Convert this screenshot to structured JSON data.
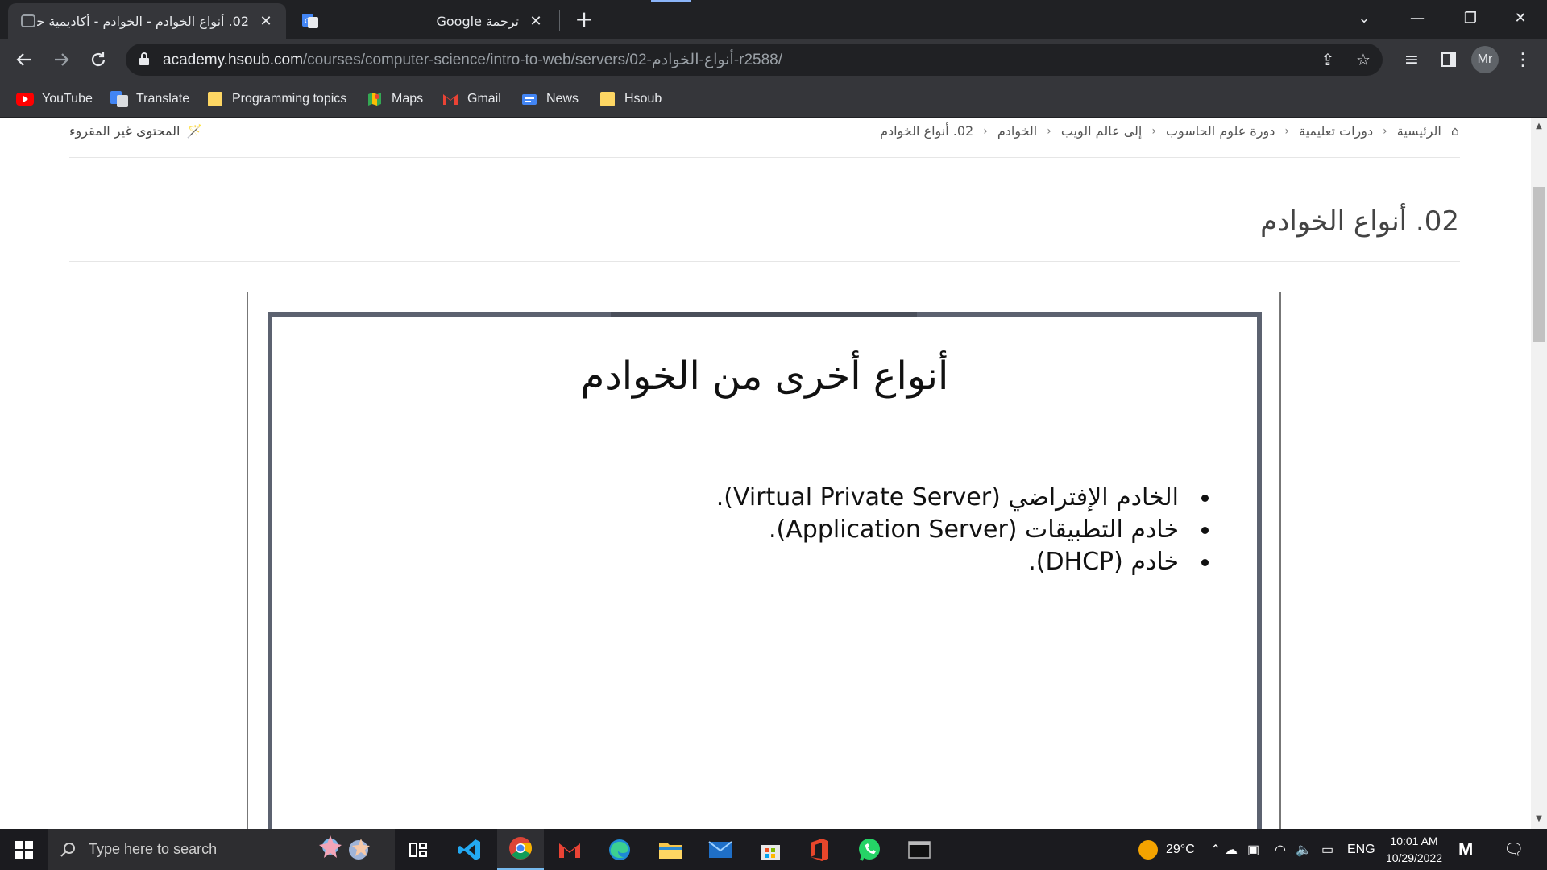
{
  "browser": {
    "tabs": [
      {
        "title": "02. أنواع الخوادم - الخوادم - أكاديمية حسوب",
        "active": true,
        "icon": "hsoub-favicon-icon"
      },
      {
        "title": "ترجمة Google",
        "active": false,
        "icon": "google-translate-icon"
      }
    ],
    "url_host": "academy.hsoub.com",
    "url_path": "/courses/computer-science/intro-to-web/servers/02-أنواع-الخوادم-r2588/",
    "profile_initials": "Mr",
    "bookmarks": [
      {
        "label": "YouTube",
        "icon": "youtube-icon"
      },
      {
        "label": "Translate",
        "icon": "google-translate-icon"
      },
      {
        "label": "Programming topics",
        "icon": "folder-icon"
      },
      {
        "label": "Maps",
        "icon": "maps-icon"
      },
      {
        "label": "Gmail",
        "icon": "gmail-icon"
      },
      {
        "label": "News",
        "icon": "news-icon"
      },
      {
        "label": "Hsoub",
        "icon": "folder-icon"
      }
    ]
  },
  "page": {
    "breadcrumb": [
      "الرئيسية",
      "دورات تعليمية",
      "دورة علوم الحاسوب",
      "إلى عالم الويب",
      "الخوادم",
      "02. أنواع الخوادم"
    ],
    "unread_label": "المحتوى غير المقروء",
    "title": "02. أنواع الخوادم",
    "slide": {
      "heading": "أنواع أخرى من الخوادم",
      "items": [
        "الخادم الإفتراضي (Virtual Private Server).",
        "خادم التطبيقات (Application Server).",
        "خادم (DHCP)."
      ]
    }
  },
  "taskbar": {
    "search_placeholder": "Type here to search",
    "weather": "29°C",
    "language": "ENG",
    "time": "10:01 AM",
    "date": "10/29/2022"
  }
}
